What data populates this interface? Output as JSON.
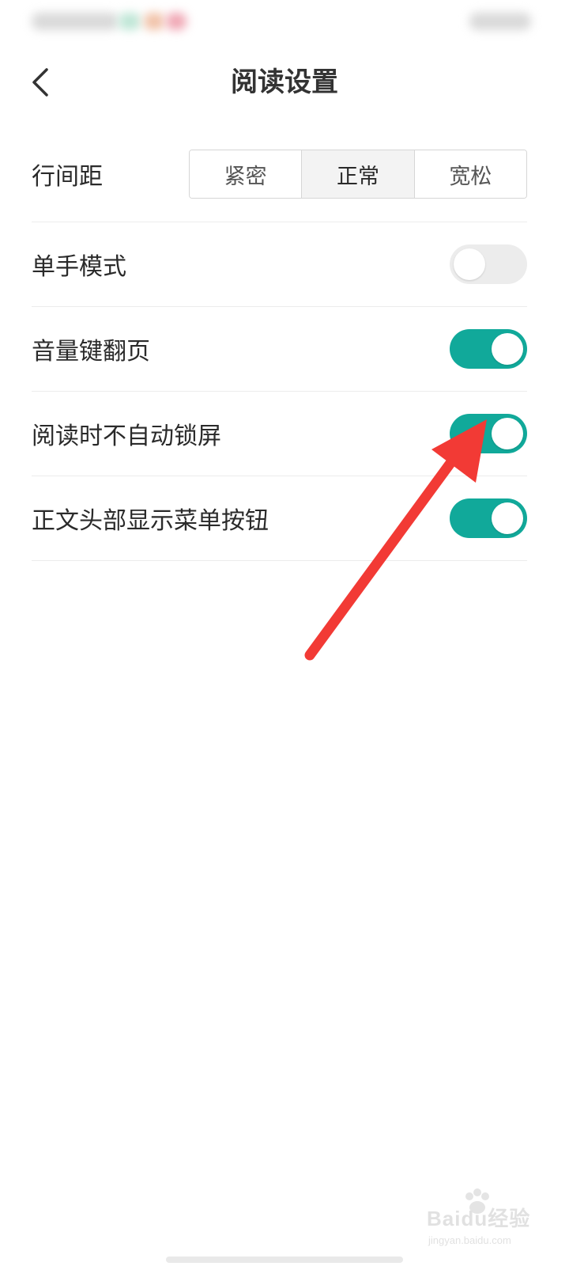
{
  "header": {
    "title": "阅读设置",
    "back_icon": "chevron-left-icon"
  },
  "settings": {
    "line_spacing": {
      "label": "行间距",
      "options": [
        "紧密",
        "正常",
        "宽松"
      ],
      "selected": "正常"
    },
    "one_hand_mode": {
      "label": "单手模式",
      "enabled": false
    },
    "volume_key_page_turn": {
      "label": "音量键翻页",
      "enabled": true
    },
    "keep_screen_on": {
      "label": "阅读时不自动锁屏",
      "enabled": true
    },
    "show_menu_button": {
      "label": "正文头部显示菜单按钮",
      "enabled": true
    }
  },
  "colors": {
    "toggle_on": "#11a99a",
    "toggle_off": "#ececec",
    "annotation_arrow": "#f23a35"
  },
  "watermark": {
    "brand": "Baidu经验",
    "url": "jingyan.baidu.com"
  }
}
